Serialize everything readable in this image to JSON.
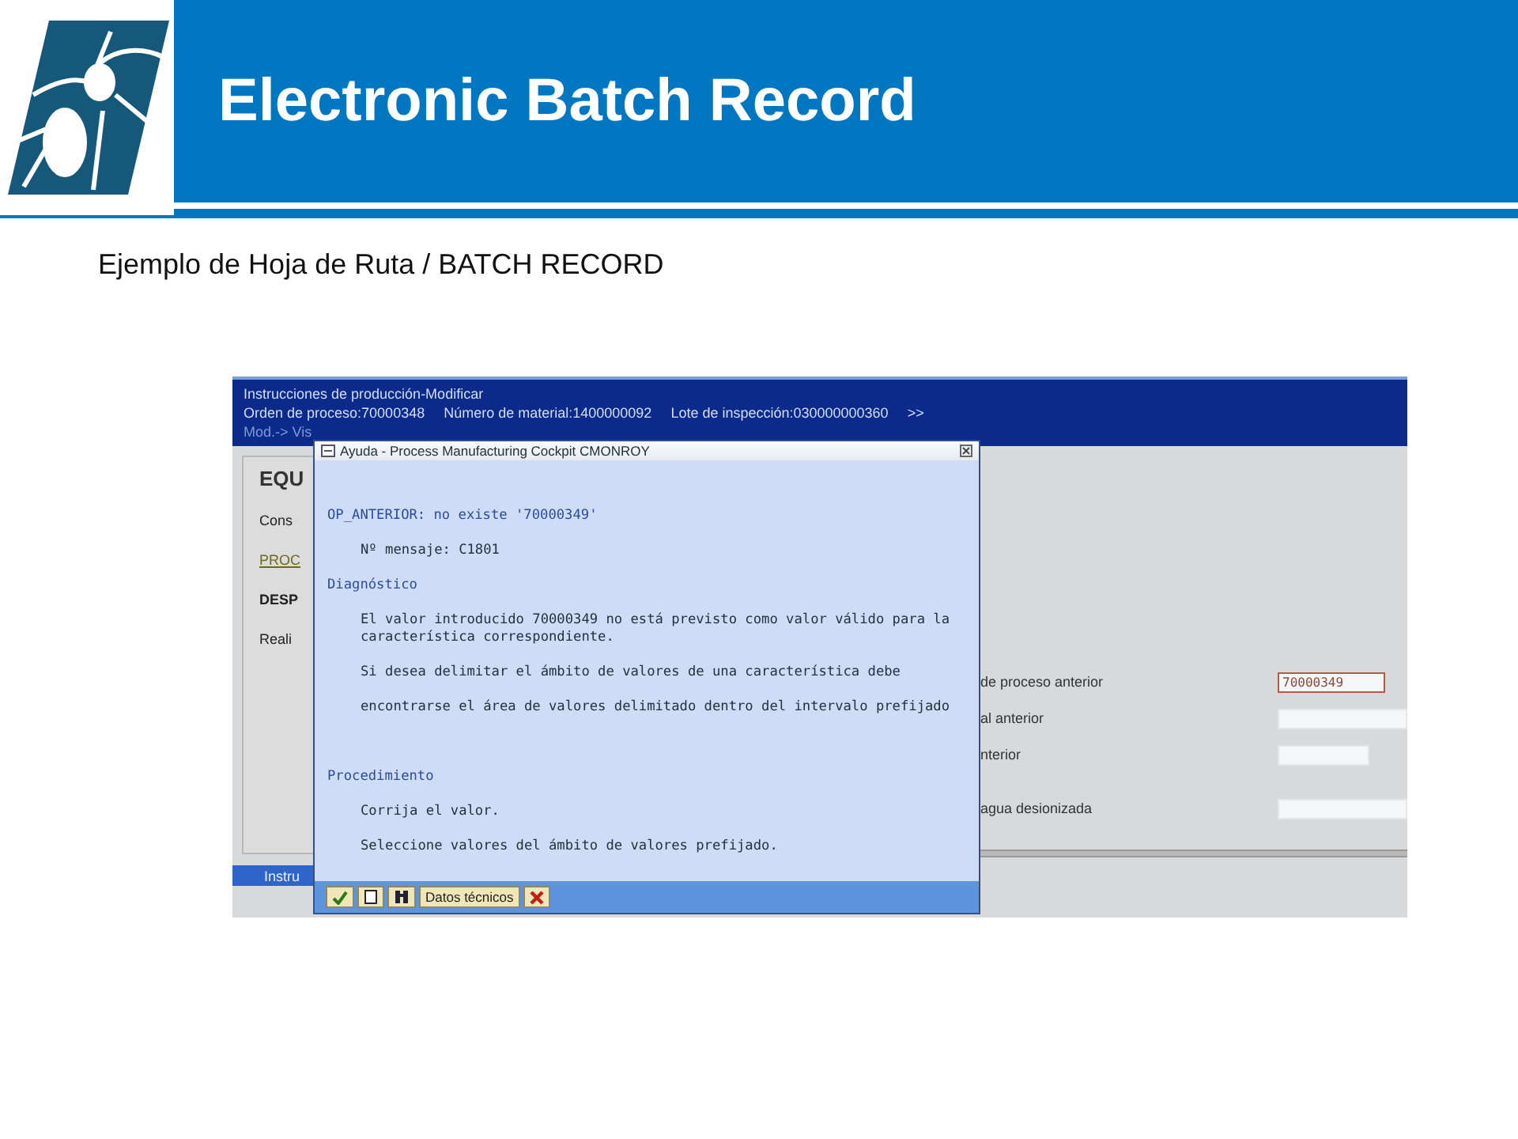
{
  "slide": {
    "title": "Electronic Batch Record",
    "subtitle": "Ejemplo de Hoja de Ruta / BATCH RECORD"
  },
  "app": {
    "title": "Instrucciones de producción-Modificar",
    "info": [
      "Orden de proceso:70000348",
      "Número de material:1400000092",
      "Lote de inspección:030000000360",
      ">>"
    ],
    "menu": [
      "Mod.-> Vis"
    ],
    "left_labels": [
      {
        "kind": "heading",
        "text": "EQU"
      },
      {
        "kind": "plain",
        "text": "Cons"
      },
      {
        "kind": "link",
        "text": "PROC"
      },
      {
        "kind": "bold",
        "text": "DESP"
      },
      {
        "kind": "plain",
        "text": "Reali"
      }
    ],
    "form_rows": [
      {
        "label": "de proceso anterior",
        "value": "70000349",
        "error": true
      },
      {
        "label": "al anterior",
        "error": false
      },
      {
        "label": "nterior",
        "error": false
      },
      {
        "label": "agua desionizada",
        "error": false
      }
    ],
    "bottom_tab": "Instru"
  },
  "popup": {
    "title": "Ayuda - Process Manufacturing Cockpit CMONROY",
    "lines": [
      {
        "kind": "title",
        "text": "OP_ANTERIOR:  no existe '70000349'"
      },
      {
        "kind": "text",
        "text": "Nº mensaje: C1801"
      },
      {
        "kind": "heading",
        "text": "Diagnóstico"
      },
      {
        "kind": "text",
        "text": "El valor introducido 70000349 no está previsto como valor válido para la característica correspondiente."
      },
      {
        "kind": "text",
        "text": "Si desea delimitar el ámbito de valores de una característica debe"
      },
      {
        "kind": "text",
        "text": "encontrarse el área de valores delimitado dentro del intervalo prefijado"
      },
      {
        "kind": "gap_heading",
        "text": "Procedimiento"
      },
      {
        "kind": "text",
        "text": "Corrija el valor."
      },
      {
        "kind": "text",
        "text": "Seleccione valores del ámbito de valores prefijado."
      }
    ],
    "toolbar": [
      {
        "kind": "check"
      },
      {
        "kind": "print"
      },
      {
        "kind": "find"
      },
      {
        "kind": "text",
        "label": "Datos técnicos"
      },
      {
        "kind": "cancel"
      }
    ]
  }
}
